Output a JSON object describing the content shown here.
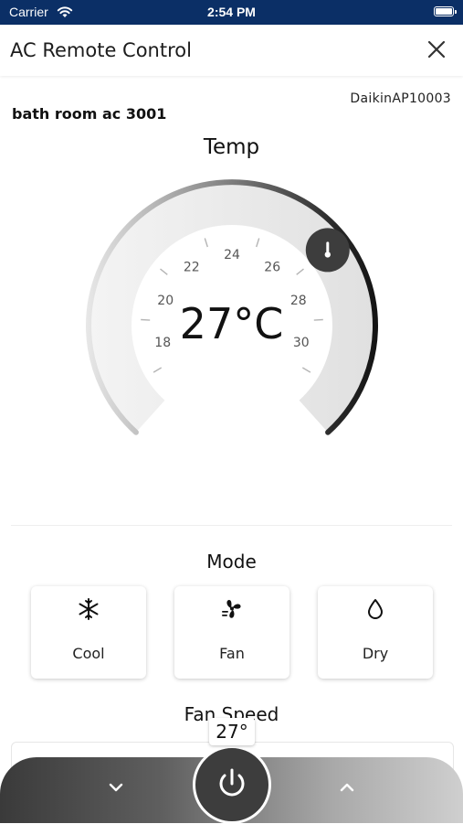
{
  "status_bar": {
    "carrier": "Carrier",
    "time": "2:54 PM"
  },
  "nav": {
    "title": "AC Remote Control"
  },
  "device": {
    "id": "DaikinAP10003",
    "room_name": "bath room ac 3001"
  },
  "temperature": {
    "title": "Temp",
    "value": 27,
    "display": "27°C",
    "min": 16,
    "max": 32,
    "tick_labels": [
      "18",
      "20",
      "22",
      "24",
      "26",
      "28",
      "30"
    ]
  },
  "mode": {
    "title": "Mode",
    "options": [
      {
        "label": "Cool",
        "icon": "snowflake-icon"
      },
      {
        "label": "Fan",
        "icon": "fan-icon"
      },
      {
        "label": "Dry",
        "icon": "water-drop-icon"
      }
    ]
  },
  "fan_speed": {
    "title": "Fan Speed"
  },
  "bottom_bar": {
    "temp_bubble": "27°",
    "down_icon": "chevron-down-icon",
    "power_icon": "power-icon",
    "up_icon": "chevron-up-icon"
  },
  "colors": {
    "status_bar": "#0b2f66",
    "dial_dark": "#1a1a1a",
    "power_button": "#3d3d3d"
  }
}
